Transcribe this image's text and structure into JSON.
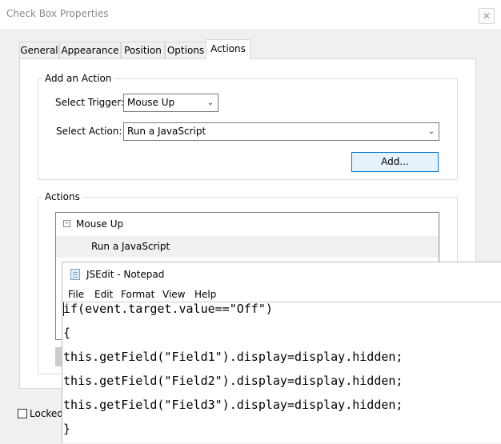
{
  "dialog": {
    "title": "Check Box Properties",
    "close_glyph": "✕"
  },
  "tabs": [
    {
      "label": "General"
    },
    {
      "label": "Appearance"
    },
    {
      "label": "Position"
    },
    {
      "label": "Options"
    },
    {
      "label": "Actions",
      "active": true
    }
  ],
  "add_action": {
    "group_label": "Add an Action",
    "trigger_label": "Select Trigger:",
    "trigger_value": "Mouse Up",
    "action_label": "Select Action:",
    "action_value": "Run a JavaScript",
    "add_button": "Add..."
  },
  "actions": {
    "group_label": "Actions",
    "tree_root": "Mouse Up",
    "tree_child": "Run a JavaScript"
  },
  "footer": {
    "locked_label": "Locked"
  },
  "notepad": {
    "title": "JSEdit - Notepad",
    "menu": [
      "File",
      "Edit",
      "Format",
      "View",
      "Help"
    ],
    "lines": [
      "if(event.target.value==\"Off\")",
      "{",
      "this.getField(\"Field1\").display=display.hidden;",
      "this.getField(\"Field2\").display=display.hidden;",
      "this.getField(\"Field3\").display=display.hidden;",
      "}"
    ]
  }
}
